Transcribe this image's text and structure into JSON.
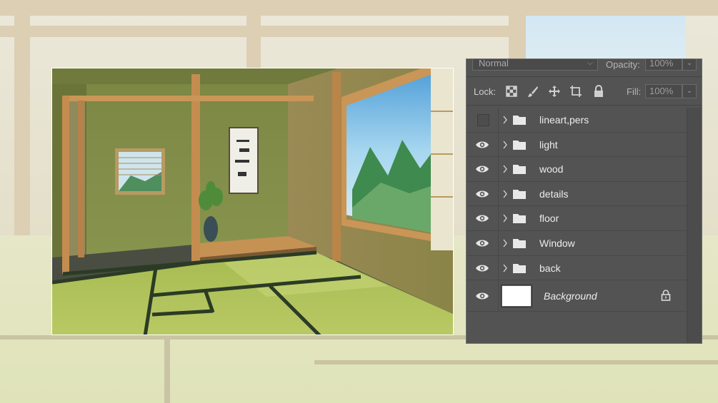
{
  "panel": {
    "blend_mode": "Normal",
    "opacity_label": "Opacity:",
    "opacity_value": "100%",
    "lock_label": "Lock:",
    "fill_label": "Fill:",
    "fill_value": "100%"
  },
  "layers": [
    {
      "name": "lineart,pers",
      "visible": false,
      "type": "group"
    },
    {
      "name": "light",
      "visible": true,
      "type": "group"
    },
    {
      "name": "wood",
      "visible": true,
      "type": "group"
    },
    {
      "name": "details",
      "visible": true,
      "type": "group"
    },
    {
      "name": "floor",
      "visible": true,
      "type": "group"
    },
    {
      "name": "Window",
      "visible": true,
      "type": "group"
    },
    {
      "name": "back",
      "visible": true,
      "type": "group"
    }
  ],
  "background_layer": {
    "name": "Background",
    "locked": true
  },
  "colors": {
    "panel_bg": "#535353",
    "tatami": "#a9bf55",
    "wall": "#7f8a45",
    "wood": "#c08a4c"
  }
}
